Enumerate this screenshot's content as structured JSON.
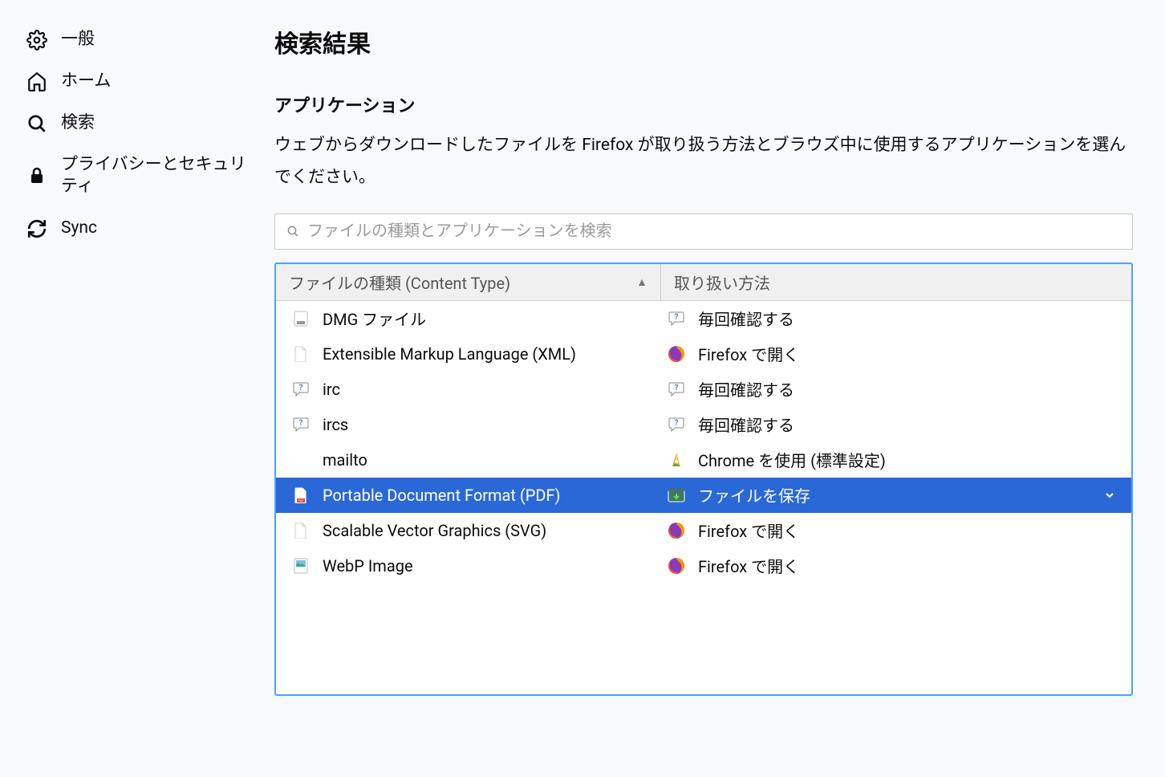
{
  "sidebar": {
    "items": [
      {
        "label": "一般",
        "icon": "gear"
      },
      {
        "label": "ホーム",
        "icon": "home"
      },
      {
        "label": "検索",
        "icon": "search"
      },
      {
        "label": "プライバシーとセキュリティ",
        "icon": "lock"
      },
      {
        "label": "Sync",
        "icon": "sync"
      }
    ]
  },
  "main": {
    "title": "検索結果",
    "section_title": "アプリケーション",
    "section_desc": "ウェブからダウンロードしたファイルを Firefox が取り扱う方法とブラウズ中に使用するアプリケーションを選んでください。",
    "search_placeholder": "ファイルの種類とアプリケーションを検索",
    "columns": {
      "type": "ファイルの種類 (Content Type)",
      "action": "取り扱い方法"
    },
    "rows": [
      {
        "type_icon": "dmg",
        "type": "DMG ファイル",
        "action_icon": "ask",
        "action": "毎回確認する",
        "selected": false
      },
      {
        "type_icon": "file",
        "type": "Extensible Markup Language (XML)",
        "action_icon": "firefox",
        "action": "Firefox で開く",
        "selected": false
      },
      {
        "type_icon": "ask",
        "type": "irc",
        "action_icon": "ask",
        "action": "毎回確認する",
        "selected": false
      },
      {
        "type_icon": "ask",
        "type": "ircs",
        "action_icon": "ask",
        "action": "毎回確認する",
        "selected": false
      },
      {
        "type_icon": "blank",
        "type": "mailto",
        "action_icon": "chrome",
        "action": "Chrome を使用 (標準設定)",
        "selected": false
      },
      {
        "type_icon": "pdf",
        "type": "Portable Document Format (PDF)",
        "action_icon": "save",
        "action": "ファイルを保存",
        "selected": true
      },
      {
        "type_icon": "file",
        "type": "Scalable Vector Graphics (SVG)",
        "action_icon": "firefox",
        "action": "Firefox で開く",
        "selected": false
      },
      {
        "type_icon": "img",
        "type": "WebP Image",
        "action_icon": "firefox",
        "action": "Firefox で開く",
        "selected": false
      }
    ]
  }
}
